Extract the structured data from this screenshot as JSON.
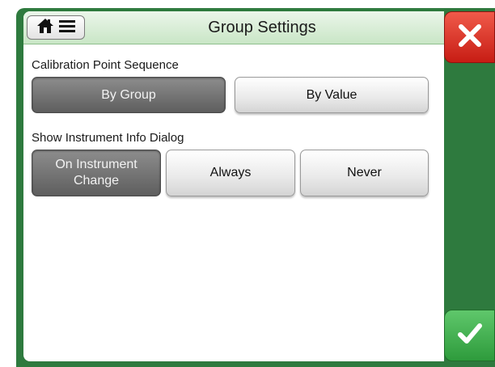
{
  "header": {
    "title": "Group Settings",
    "menu_icons": [
      "home-icon",
      "menu-lines-icon"
    ]
  },
  "sections": [
    {
      "label": "Calibration Point Sequence",
      "options": [
        "By Group",
        "By Value"
      ],
      "selected": "By Group"
    },
    {
      "label": "Show Instrument Info Dialog",
      "options": [
        "On Instrument Change",
        "Always",
        "Never"
      ],
      "option_lines": [
        [
          "On Instrument",
          "Change"
        ],
        [
          "Always"
        ],
        [
          "Never"
        ]
      ],
      "selected": "On Instrument Change"
    }
  ],
  "actions": {
    "close_icon": "close-x-icon",
    "accept_icon": "checkmark-icon"
  },
  "colors": {
    "frame": "#2e7a3e",
    "header": "#d9efd6",
    "selected": "#6e6e6e",
    "close": "#e0372b",
    "accept": "#3daf4a"
  }
}
